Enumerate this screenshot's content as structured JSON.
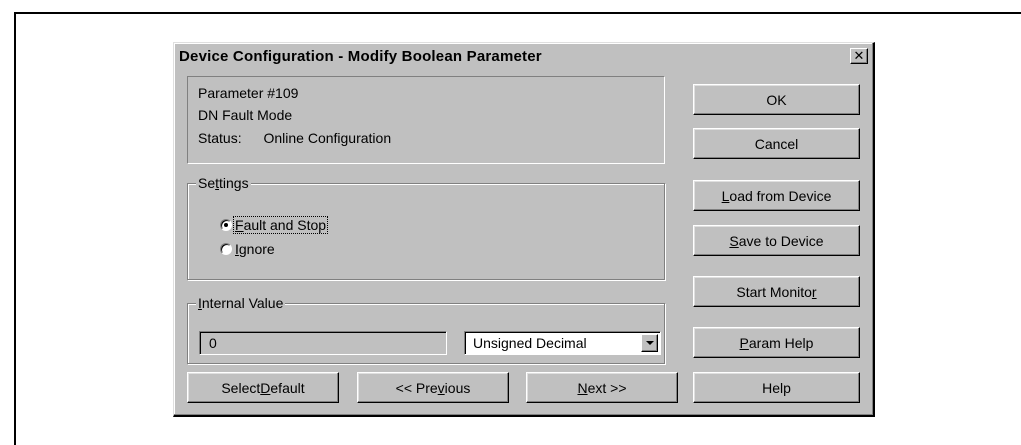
{
  "window": {
    "title": "Device Configuration - Modify Boolean Parameter",
    "close_glyph": "✕"
  },
  "info": {
    "parameter": "Parameter #109",
    "name": "DN Fault Mode",
    "status_label": "Status:",
    "status_value": "Online Configuration"
  },
  "settings": {
    "label_pre": "Se",
    "label_mnemonic": "t",
    "label_post": "tings",
    "options": [
      {
        "pre": "",
        "mnemonic": "F",
        "post": "ault and Stop",
        "selected": true
      },
      {
        "pre": "",
        "mnemonic": "I",
        "post": "gnore",
        "selected": false
      }
    ]
  },
  "internal_value": {
    "label_pre": "",
    "label_mnemonic": "I",
    "label_post": "nternal Value",
    "value": "0",
    "format": "Unsigned Decimal"
  },
  "bottom_buttons": {
    "select_default": {
      "pre": "Select ",
      "mnemonic": "D",
      "post": "efault"
    },
    "previous": {
      "pre": "<< Pre",
      "mnemonic": "v",
      "post": "ious"
    },
    "next": {
      "pre": "",
      "mnemonic": "N",
      "post": "ext >>"
    }
  },
  "side_buttons": {
    "ok": "OK",
    "cancel": "Cancel",
    "load": {
      "pre": "",
      "mnemonic": "L",
      "post": "oad from Device"
    },
    "save": {
      "pre": "",
      "mnemonic": "S",
      "post": "ave to Device"
    },
    "monitor": {
      "pre": "Start Monito",
      "mnemonic": "r",
      "post": ""
    },
    "param_help": {
      "pre": "",
      "mnemonic": "P",
      "post": "aram Help"
    },
    "help": "Help"
  }
}
